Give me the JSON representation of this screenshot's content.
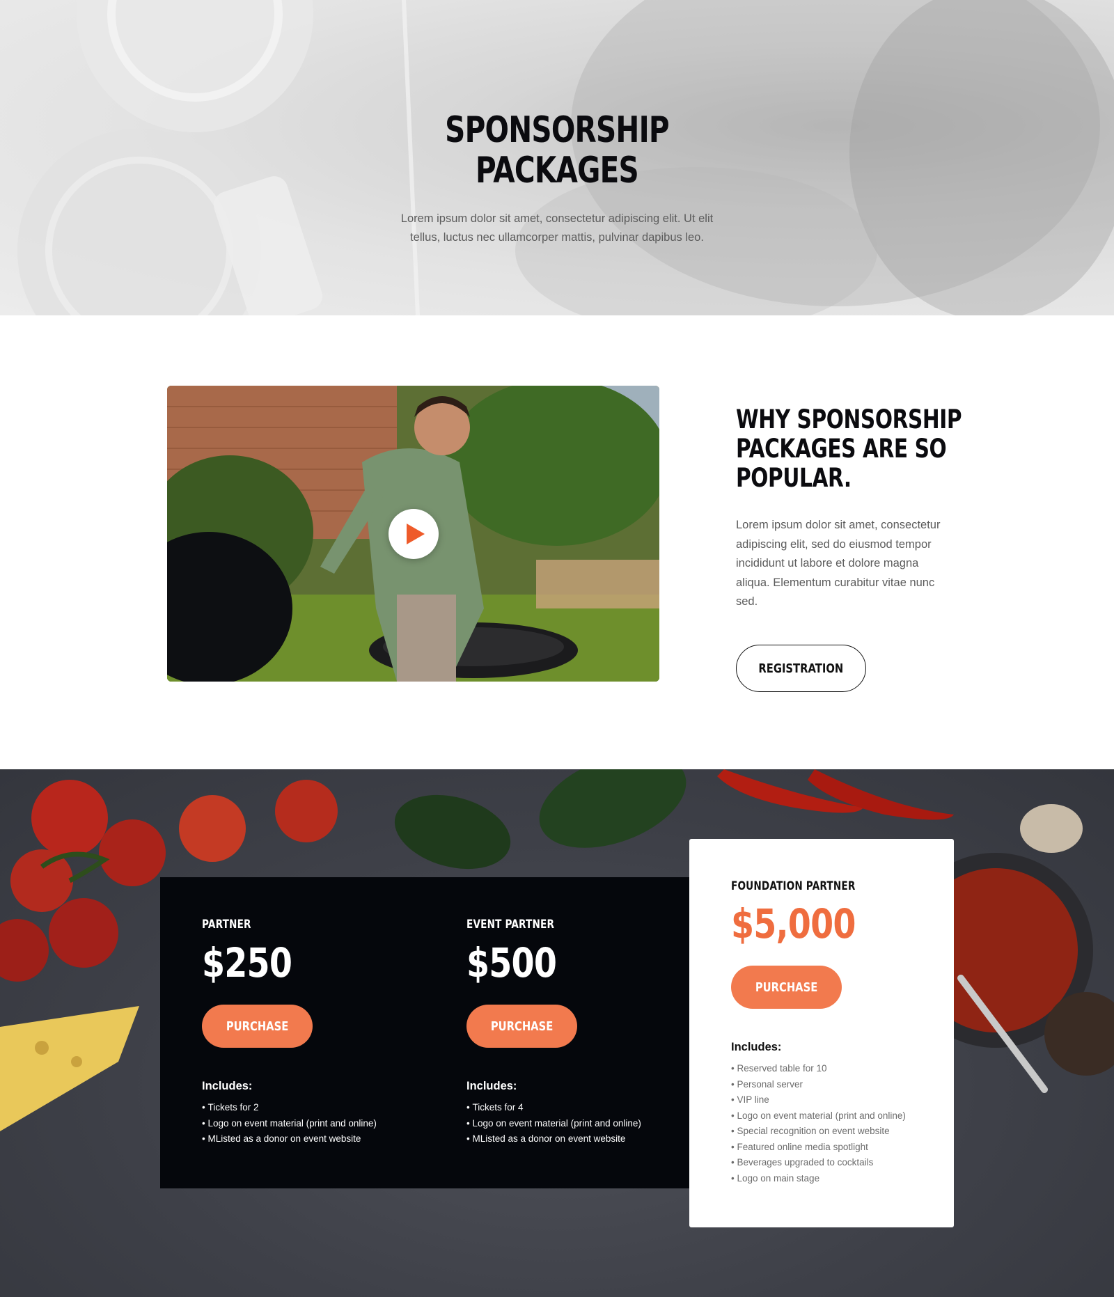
{
  "hero": {
    "title_line1": "SPONSORSHIP",
    "title_line2": "PACKAGES",
    "text": "Lorem ipsum dolor sit amet, consectetur adipiscing elit. Ut elit tellus, luctus nec ullamcorper mattis, pulvinar dapibus leo."
  },
  "about": {
    "title": "WHY SPONSORSHIP PACKAGES ARE SO POPULAR.",
    "text": "Lorem ipsum dolor sit amet, consectetur adipiscing elit, sed do eiusmod tempor incididunt ut labore et dolore magna aliqua. Elementum curabitur vitae nunc sed.",
    "button_label": "REGISTRATION",
    "video_icon": "play-icon"
  },
  "pricing": {
    "accent_color": "#f27a4e",
    "panel_color": "#05070c",
    "tiers": [
      {
        "name": "PARTNER",
        "price": "$250",
        "button_label": "PURCHASE",
        "includes_title": "Includes:",
        "includes": [
          "Tickets for 2",
          "Logo on event material (print and online)",
          "MListed as a donor on event website"
        ]
      },
      {
        "name": "EVENT PARTNER",
        "price": "$500",
        "button_label": "PURCHASE",
        "includes_title": "Includes:",
        "includes": [
          "Tickets for 4",
          "Logo on event material (print and online)",
          "MListed as a donor on event website"
        ]
      },
      {
        "name": "FOUNDATION PARTNER",
        "price": "$5,000",
        "button_label": "PURCHASE",
        "includes_title": "Includes:",
        "includes": [
          "Reserved table for 10",
          "Personal server",
          "VIP line",
          "Logo on event material (print and online)",
          "Special recognition on event website",
          "Featured online media spotlight",
          "Beverages upgraded to cocktails",
          "Logo on main stage"
        ]
      }
    ]
  }
}
